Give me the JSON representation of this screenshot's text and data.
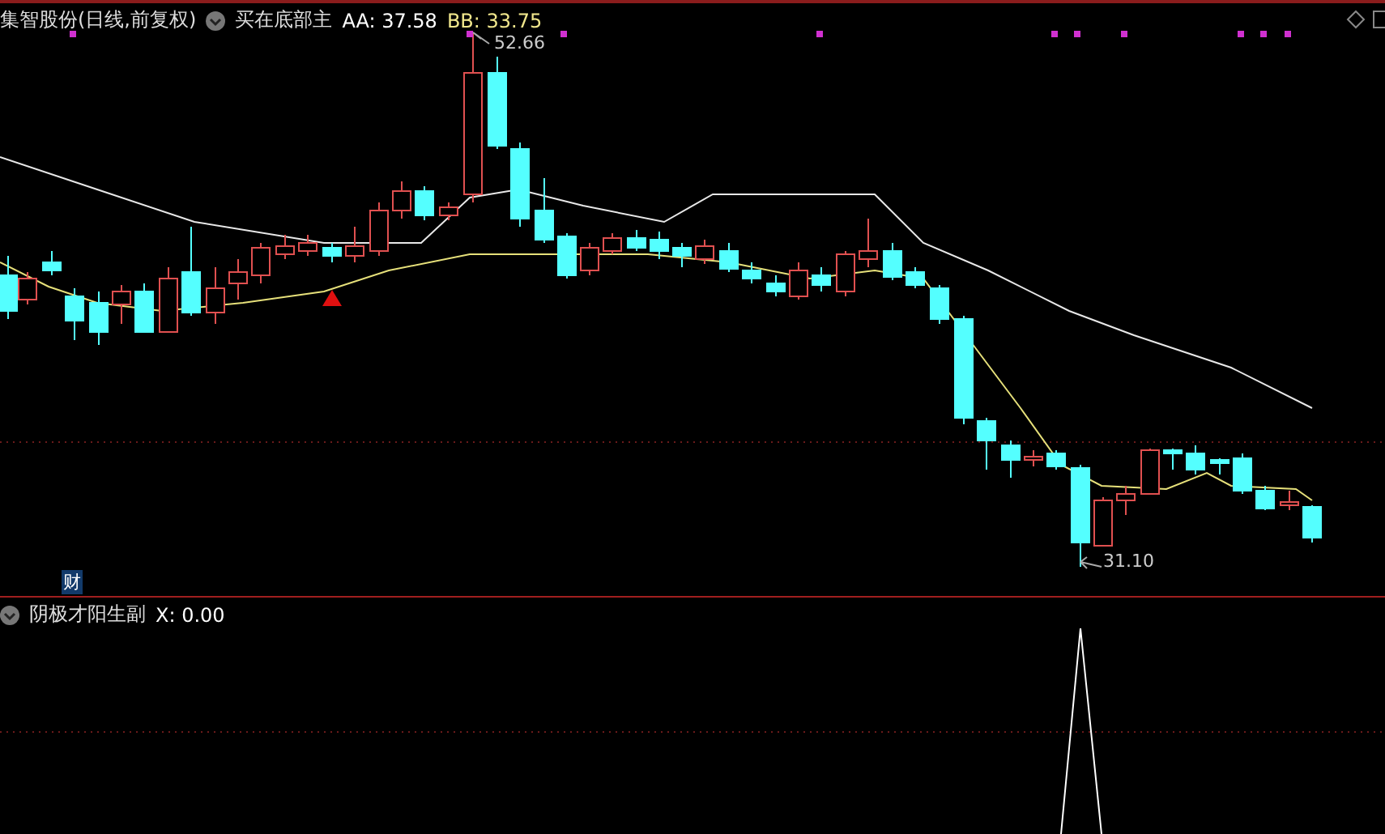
{
  "main_panel": {
    "stock_title": "集智股份(日线,前复权)",
    "indicator_name": "买在底部主",
    "readings": [
      {
        "label": "AA: 37.58",
        "kind": "plain"
      },
      {
        "label": "BB: 33.75",
        "kind": "accent"
      }
    ],
    "high_label": "52.66",
    "low_label": "31.10",
    "badge": "财"
  },
  "sub_panel": {
    "indicator_name": "阴极才阳生副",
    "reading": "X: 0.00"
  }
}
